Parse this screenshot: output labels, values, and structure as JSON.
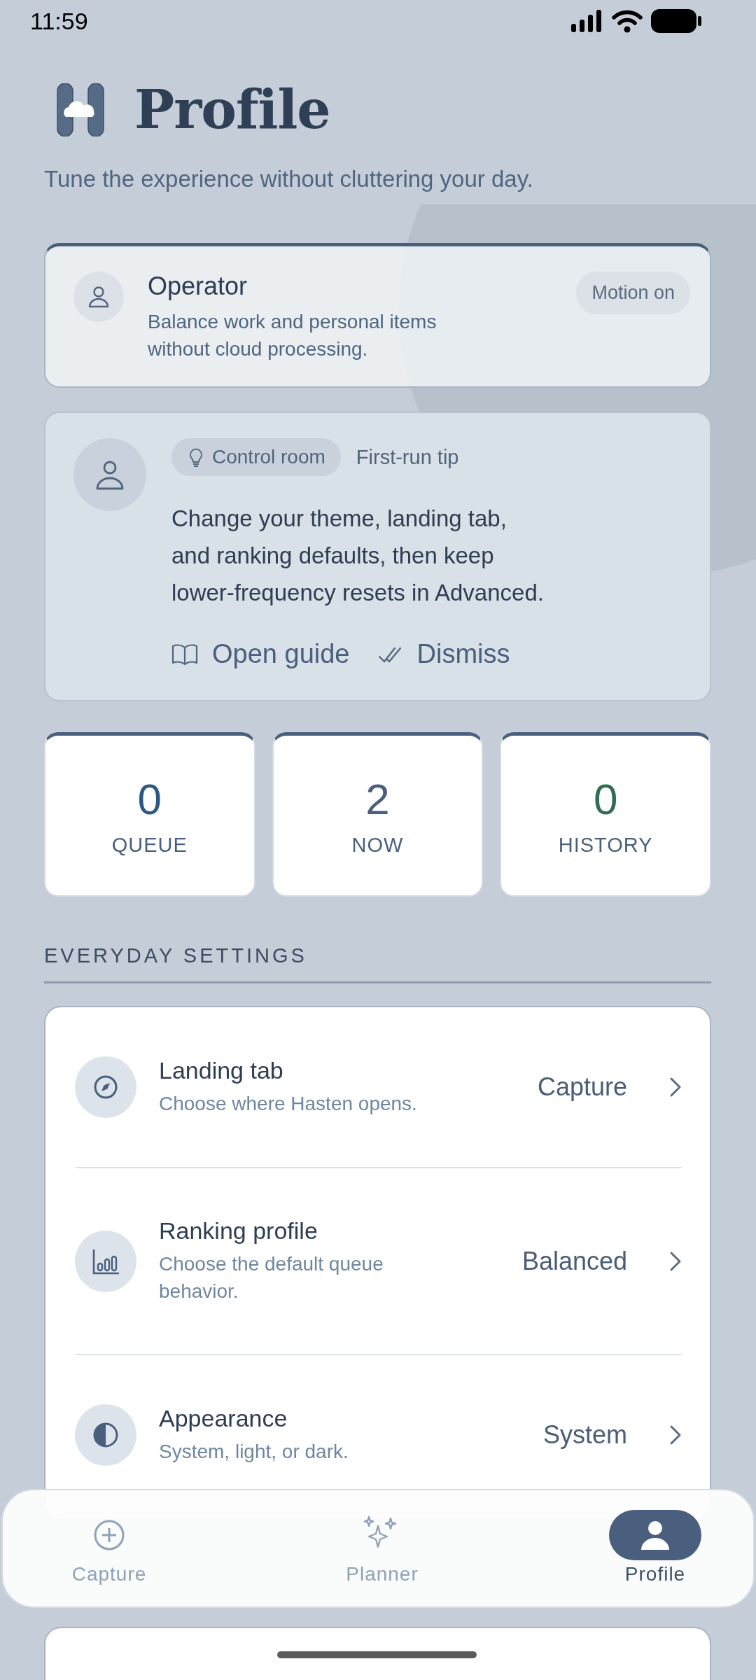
{
  "status_bar": {
    "time": "11:59"
  },
  "header": {
    "title": "Profile",
    "subtitle": "Tune the experience without cluttering your day."
  },
  "operator_card": {
    "title": "Operator",
    "description": "Balance work and personal items without cloud processing.",
    "badge": "Motion on"
  },
  "tip_card": {
    "chip": "Control room",
    "label": "First-run tip",
    "body": "Change your theme, landing tab, and ranking defaults, then keep lower-frequency resets in Advanced.",
    "actions": [
      {
        "label": "Open guide"
      },
      {
        "label": "Dismiss"
      }
    ]
  },
  "stats": [
    {
      "value": "0",
      "label": "QUEUE",
      "color": "#2f5880"
    },
    {
      "value": "2",
      "label": "NOW",
      "color": "#4a5f7d"
    },
    {
      "value": "0",
      "label": "HISTORY",
      "color": "#2f6e50"
    }
  ],
  "sections": [
    {
      "heading": "EVERYDAY SETTINGS",
      "items": [
        {
          "title": "Landing tab",
          "description": "Choose where Hasten opens.",
          "value": "Capture"
        },
        {
          "title": "Ranking profile",
          "description": "Choose the default queue behavior.",
          "value": "Balanced"
        },
        {
          "title": "Appearance",
          "description": "System, light, or dark.",
          "value": "System"
        }
      ]
    }
  ],
  "bottom_nav": [
    {
      "label": "Capture",
      "selected": false
    },
    {
      "label": "Planner",
      "selected": false
    },
    {
      "label": "Profile",
      "selected": true
    }
  ]
}
